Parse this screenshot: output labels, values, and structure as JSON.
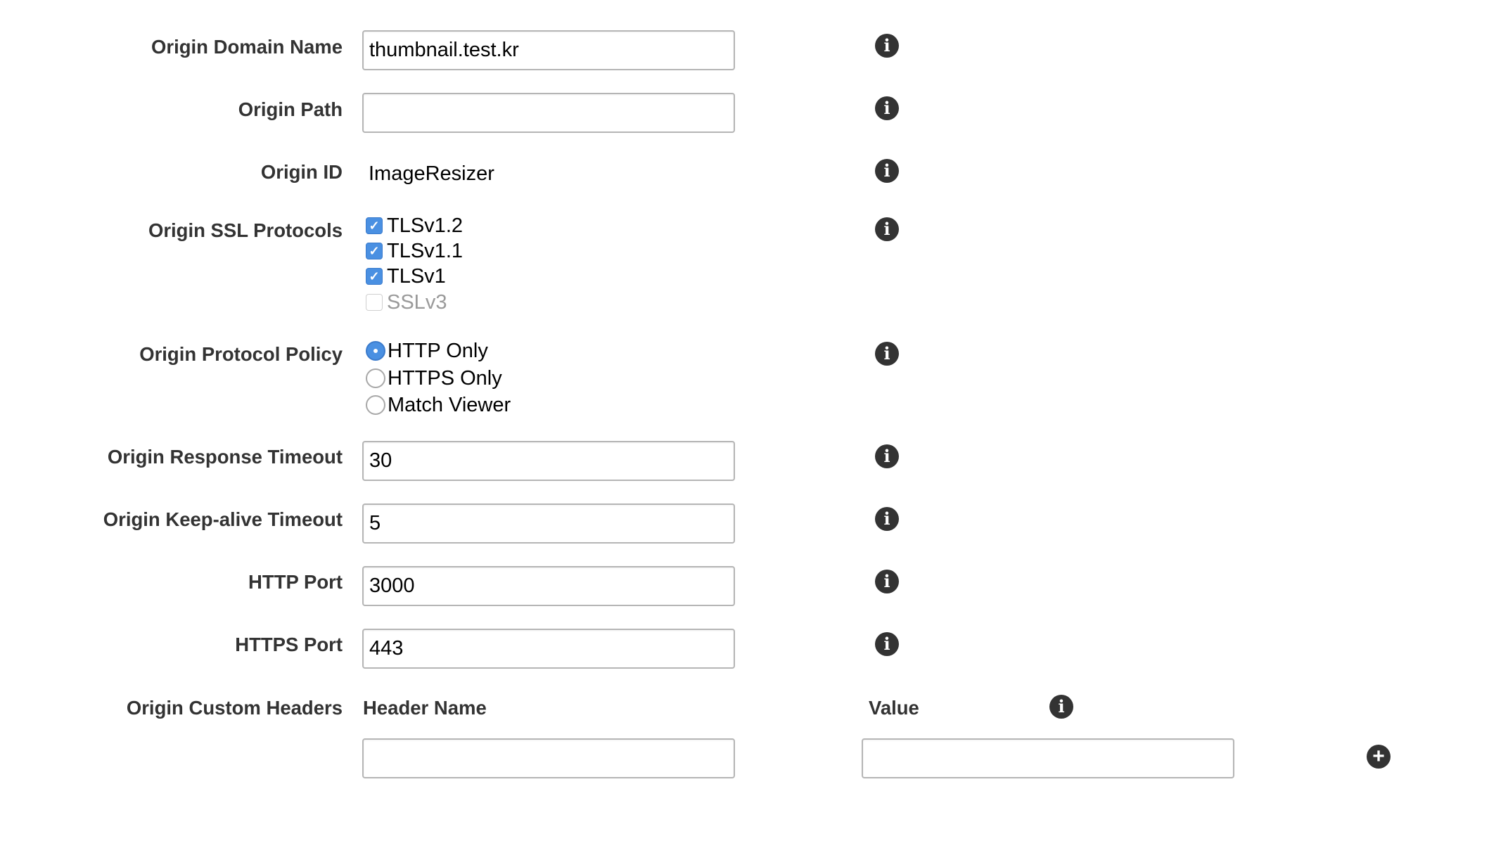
{
  "form": {
    "domain_name": {
      "label": "Origin Domain Name",
      "value": "thumbnail.test.kr"
    },
    "path": {
      "label": "Origin Path",
      "value": ""
    },
    "origin_id": {
      "label": "Origin ID",
      "value": "ImageResizer"
    },
    "ssl_protocols": {
      "label": "Origin SSL Protocols",
      "options": [
        {
          "label": "TLSv1.2",
          "checked": true
        },
        {
          "label": "TLSv1.1",
          "checked": true
        },
        {
          "label": "TLSv1",
          "checked": true
        },
        {
          "label": "SSLv3",
          "checked": false,
          "disabled": true
        }
      ]
    },
    "protocol_policy": {
      "label": "Origin Protocol Policy",
      "options": [
        {
          "label": "HTTP Only",
          "selected": true
        },
        {
          "label": "HTTPS Only",
          "selected": false
        },
        {
          "label": "Match Viewer",
          "selected": false
        }
      ]
    },
    "response_timeout": {
      "label": "Origin Response Timeout",
      "value": "30"
    },
    "keepalive_timeout": {
      "label": "Origin Keep-alive Timeout",
      "value": "5"
    },
    "http_port": {
      "label": "HTTP Port",
      "value": "3000"
    },
    "https_port": {
      "label": "HTTPS Port",
      "value": "443"
    },
    "custom_headers": {
      "label": "Origin Custom Headers",
      "header_name_col": "Header Name",
      "value_col": "Value",
      "rows": [
        {
          "name": "",
          "value": ""
        }
      ]
    }
  },
  "icons": {
    "info": "info-icon",
    "add": "plus-circle-icon"
  },
  "colors": {
    "accent": "#4a90e2",
    "label_text": "#333333",
    "input_border": "#b5b5b5"
  }
}
